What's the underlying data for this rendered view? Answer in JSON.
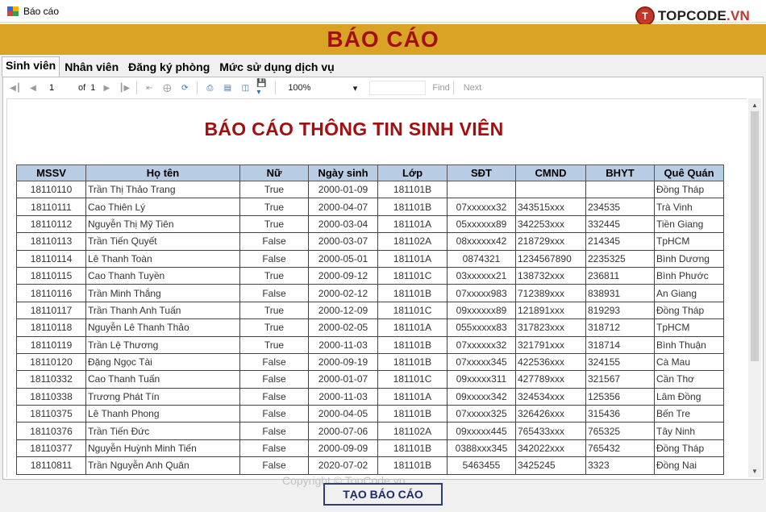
{
  "window": {
    "title": "Báo cáo",
    "brand": {
      "badge": "T",
      "text_main": "TOPCODE",
      "text_suffix": ".VN"
    }
  },
  "header": {
    "title": "BÁO CÁO"
  },
  "tabs": [
    {
      "label": "Sinh viên",
      "active": true
    },
    {
      "label": "Nhân viên",
      "active": false
    },
    {
      "label": "Đăng ký phòng",
      "active": false
    },
    {
      "label": "Mức sử dụng dịch vụ",
      "active": false
    }
  ],
  "toolbar": {
    "page_value": "1",
    "of_label": "of",
    "page_total": "1",
    "zoom": "100%",
    "find_label": "Find",
    "next_label": "Next",
    "icons": [
      "first-page-icon",
      "prev-page-icon",
      "next-page-icon",
      "last-page-icon",
      "back-icon",
      "stop-icon",
      "refresh-icon",
      "print-icon",
      "print-layout-icon",
      "page-setup-icon",
      "export-icon"
    ]
  },
  "report": {
    "title": "BÁO CÁO THÔNG TIN SINH VIÊN",
    "columns": [
      "MSSV",
      "Họ tên",
      "Nữ",
      "Ngày sinh",
      "Lớp",
      "SĐT",
      "CMND",
      "BHYT",
      "Quê Quán"
    ],
    "rows": [
      [
        "18110110",
        "Trần Thị Thảo Trang",
        "True",
        "2000-01-09",
        "181101B",
        "",
        "",
        "",
        "Đồng Tháp"
      ],
      [
        "18110111",
        "Cao Thiên Lý",
        "True",
        "2000-04-07",
        "181101B",
        "07xxxxxx32",
        "343515xxx",
        "234535",
        "Trà Vinh"
      ],
      [
        "18110112",
        "Nguyễn Thị Mỹ Tiên",
        "True",
        "2000-03-04",
        "181101A",
        "05xxxxxx89",
        "342253xxx",
        "332445",
        "Tiền Giang"
      ],
      [
        "18110113",
        "Trần Tiến Quyết",
        "False",
        "2000-03-07",
        "181102A",
        "08xxxxxx42",
        "218729xxx",
        "214345",
        "TpHCM"
      ],
      [
        "18110114",
        "Lê Thanh Toàn",
        "False",
        "2000-05-01",
        "181101A",
        "0874321",
        "1234567890",
        "2235325",
        "Bình Dương"
      ],
      [
        "18110115",
        "Cao Thanh Tuyền",
        "True",
        "2000-09-12",
        "181101C",
        "03xxxxxx21",
        "138732xxx",
        "236811",
        "Bình Phước"
      ],
      [
        "18110116",
        "Trần Minh Thắng",
        "False",
        "2000-02-12",
        "181101B",
        "07xxxxx983",
        "712389xxx",
        "838931",
        "An Giang"
      ],
      [
        "18110117",
        "Trần Thanh Anh Tuấn",
        "True",
        "2000-12-09",
        "181101C",
        "09xxxxxx89",
        "121891xxx",
        "819293",
        "Đồng Tháp"
      ],
      [
        "18110118",
        "Nguyễn Lê Thanh Thảo",
        "True",
        "2000-02-05",
        "181101A",
        "055xxxxx83",
        "317823xxx",
        "318712",
        "TpHCM"
      ],
      [
        "18110119",
        "Trần Lệ Thương",
        "True",
        "2000-11-03",
        "181101B",
        "07xxxxxx32",
        "321791xxx",
        "318714",
        "Bình Thuận"
      ],
      [
        "18110120",
        "Đặng Ngọc Tài",
        "False",
        "2000-09-19",
        "181101B",
        "07xxxxx345",
        "422536xxx",
        "324155",
        "Cà Mau"
      ],
      [
        "18110332",
        "Cao Thanh Tuấn",
        "False",
        "2000-01-07",
        "181101C",
        "09xxxxx311",
        "427789xxx",
        "321567",
        "Cần Thơ"
      ],
      [
        "18110338",
        "Trương Phát Tín",
        "False",
        "2000-11-03",
        "181101A",
        "09xxxxx342",
        "324534xxx",
        "125356",
        "Lâm Đồng"
      ],
      [
        "18110375",
        "Lê Thanh Phong",
        "False",
        "2000-04-05",
        "181101B",
        "07xxxxx325",
        "326426xxx",
        "315436",
        "Bến Tre"
      ],
      [
        "18110376",
        "Trần Tiến Đức",
        "False",
        "2000-07-06",
        "181102A",
        "09xxxxx445",
        "765433xxx",
        "765325",
        "Tây Ninh"
      ],
      [
        "18110377",
        "Nguyễn Huỳnh Minh Tiến",
        "False",
        "2000-09-09",
        "181101B",
        "0388xxx345",
        "342022xxx",
        "765432",
        "Đồng Tháp"
      ],
      [
        "18110811",
        "Trần Nguyễn Anh Quân",
        "False",
        "2020-07-02",
        "181101B",
        "5463455",
        "3425245",
        "3323",
        "Đồng Nai"
      ]
    ]
  },
  "footer": {
    "watermark": "Copyright © TopCode.vn",
    "button_label": "TẠO BÁO CÁO"
  }
}
